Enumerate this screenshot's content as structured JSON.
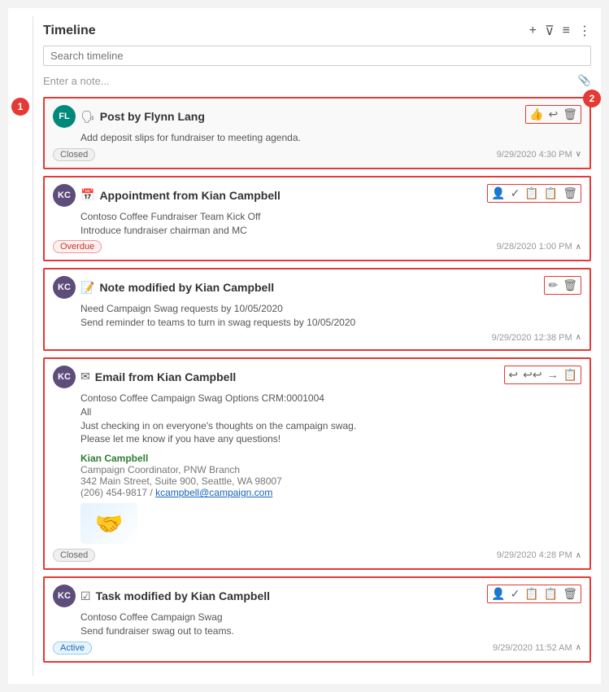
{
  "header": {
    "title": "Timeline",
    "add_icon": "+",
    "filter_icon": "⊽",
    "sort_icon": "≡",
    "more_icon": "⋮"
  },
  "search": {
    "placeholder": "Search timeline"
  },
  "note": {
    "placeholder": "Enter a note...",
    "attach_icon": "📎"
  },
  "markers": {
    "left": "1",
    "right": "2"
  },
  "items": [
    {
      "type": "Post",
      "icon": "🗣",
      "author": "Flynn Lang",
      "avatar_initials": "FL",
      "avatar_class": "avatar-fl",
      "body": "Add deposit slips for fundraiser to meeting agenda.",
      "status": "Closed",
      "status_class": "status-closed",
      "timestamp": "9/29/2020 4:30 PM",
      "actions": [
        "👍",
        "↩",
        "🗑"
      ],
      "action_names": [
        "like",
        "reply",
        "delete"
      ]
    },
    {
      "type": "Appointment",
      "icon": "📅",
      "author": "Kian Campbell",
      "avatar_initials": "KC",
      "avatar_class": "avatar-kc",
      "body_lines": [
        "Contoso Coffee Fundraiser Team Kick Off",
        "Introduce fundraiser chairman and MC"
      ],
      "status": "Overdue",
      "status_class": "status-overdue",
      "timestamp": "9/28/2020 1:00 PM",
      "actions": [
        "👤+",
        "✓",
        "📋",
        "📋",
        "🗑"
      ],
      "action_names": [
        "assign",
        "complete",
        "copy",
        "view",
        "delete"
      ]
    },
    {
      "type": "Note",
      "icon": "📝",
      "author": "Kian Campbell",
      "avatar_initials": "KC",
      "avatar_class": "avatar-kc",
      "body_lines": [
        "Need Campaign Swag requests by 10/05/2020",
        "Send reminder to teams to turn in swag requests by 10/05/2020"
      ],
      "status": null,
      "timestamp": "9/29/2020 12:38 PM",
      "actions": [
        "✏",
        "🗑"
      ],
      "action_names": [
        "edit",
        "delete"
      ]
    },
    {
      "type": "Email",
      "icon": "✉",
      "author": "Kian Campbell",
      "avatar_initials": "KC",
      "avatar_class": "avatar-kc",
      "body_lines": [
        "Contoso Coffee Campaign Swag Options CRM:0001004",
        "All",
        "Just checking in on everyone's thoughts on the campaign swag.",
        "Please let me know if you have any questions!"
      ],
      "signature": {
        "name": "Kian Campbell",
        "title": "Campaign Coordinator, PNW Branch",
        "address": "342 Main Street, Suite 900, Seattle, WA 98007",
        "phone": "(206) 454-9817",
        "email": "kcampbell@campaign.com"
      },
      "status": "Closed",
      "status_class": "status-closed",
      "timestamp": "9/29/2020 4:28 PM",
      "actions": [
        "↩",
        "↩↩",
        "→",
        "📋"
      ],
      "action_names": [
        "reply",
        "reply-all",
        "forward",
        "view"
      ]
    },
    {
      "type": "Task",
      "icon": "☑",
      "author": "Kian Campbell",
      "avatar_initials": "KC",
      "avatar_class": "avatar-kc",
      "body_lines": [
        "Contoso Coffee Campaign Swag",
        "Send fundraiser swag out to teams."
      ],
      "status": "Active",
      "status_class": "status-active",
      "timestamp": "9/29/2020 11:52 AM",
      "actions": [
        "👤+",
        "✓",
        "📋",
        "📋",
        "🗑"
      ],
      "action_names": [
        "assign",
        "complete",
        "copy",
        "view",
        "delete"
      ]
    }
  ]
}
